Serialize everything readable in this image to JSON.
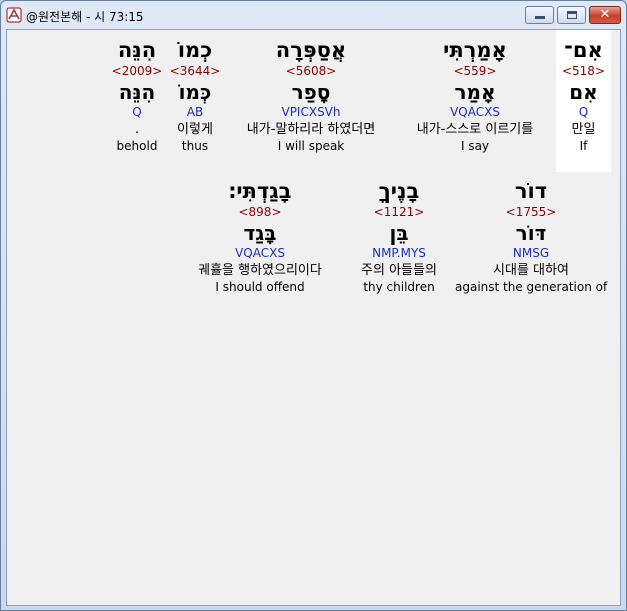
{
  "window": {
    "title": "@원전본해 - 시 73:15"
  },
  "rows": [
    [
      {
        "hebrew": "הִנֵּה",
        "strongs": "<2009>",
        "root": "הִנֵּה",
        "parsing": "Q",
        "korean": ".",
        "english": "behold",
        "highlight": false
      },
      {
        "hebrew": "כְמוֹ",
        "strongs": "<3644>",
        "root": "כְּמוֹ",
        "parsing": "AB",
        "korean": "이렇게",
        "english": "thus",
        "highlight": false
      },
      {
        "hebrew": "אֲסַפְּרָה",
        "strongs": "<5608>",
        "root": "סָפַר",
        "parsing": "VPICXSVh",
        "korean": "내가-말하리라 하였더면",
        "english": "I will speak",
        "highlight": false
      },
      {
        "hebrew": "אָמַרְתִּי",
        "strongs": "<559>",
        "root": "אָמַר",
        "parsing": "VQACXS",
        "korean": "내가-스스로 이르기를",
        "english": "I say",
        "highlight": false
      },
      {
        "hebrew": "אִם־",
        "strongs": "<518>",
        "root": "אִם",
        "parsing": "Q",
        "korean": "만일",
        "english": "If",
        "highlight": true
      }
    ],
    [
      {
        "hebrew": "בָגַדְתִּי׃",
        "strongs": "<898>",
        "root": "בָּגַד",
        "parsing": "VQACXS",
        "korean": "궤휼을 행하였으리이다",
        "english": "I should offend",
        "highlight": false
      },
      {
        "hebrew": "בָנֶיךָ",
        "strongs": "<1121>",
        "root": "בֵּן",
        "parsing": "NMP.MYS",
        "korean": "주의 아들들의",
        "english": "thy children",
        "highlight": false
      },
      {
        "hebrew": "דוֹר",
        "strongs": "<1755>",
        "root": "דּוֹר",
        "parsing": "NMSG",
        "korean": "시대를 대하여",
        "english": "against the generation of",
        "highlight": false
      }
    ]
  ]
}
